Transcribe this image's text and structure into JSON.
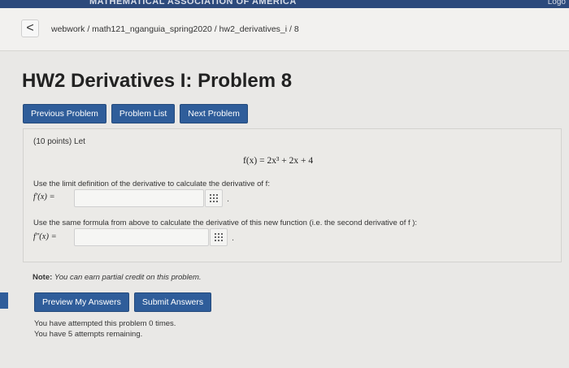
{
  "banner": {
    "text": "MATHEMATICAL ASSOCIATION OF AMERICA",
    "right_text": "Logo"
  },
  "breadcrumb": {
    "back_symbol": "<",
    "path": "webwork / math121_nganguia_spring2020 / hw2_derivatives_i / 8"
  },
  "page_title": "HW2 Derivatives I: Problem 8",
  "nav": {
    "previous_label": "Previous Problem",
    "list_label": "Problem List",
    "next_label": "Next Problem"
  },
  "problem": {
    "points": "(10 points) Let",
    "equation": "f(x) = 2x³ + 2x + 4",
    "instruction_1": "Use the limit definition of the derivative to calculate the derivative of f:",
    "label_1": "f′(x) =",
    "answer_1_value": "",
    "instruction_2": "Use the same formula from above to calculate the derivative of this new function (i.e. the second derivative of f ):",
    "label_2": "f″(x) =",
    "answer_2_value": ""
  },
  "note": {
    "label": "Note:",
    "text": "You can earn partial credit on this problem."
  },
  "submit": {
    "preview_label": "Preview My Answers",
    "submit_label": "Submit Answers"
  },
  "attempts": {
    "line_1": "You have attempted this problem 0 times.",
    "line_2": "You have 5 attempts remaining."
  },
  "colors": {
    "button_blue": "#2f5d9a",
    "banner_navy": "#2d4a7c",
    "page_background": "#e9e8e6"
  }
}
